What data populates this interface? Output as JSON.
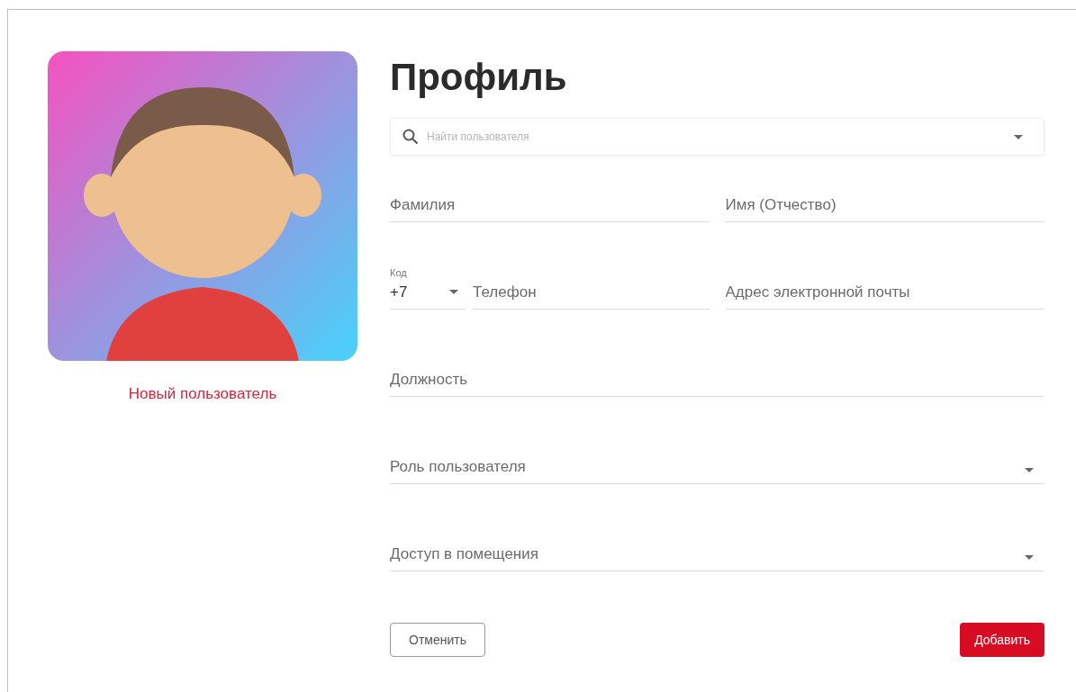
{
  "avatar": {
    "caption": "Новый пользователь"
  },
  "title": "Профиль",
  "search": {
    "placeholder": "Найти пользователя"
  },
  "fields": [
    {
      "kind": "text",
      "placeholder": "Фамилия"
    },
    {
      "kind": "text",
      "placeholder": "Имя (Отчество)"
    },
    {
      "kind": "phone",
      "code_label": "Код",
      "code_value": "+7",
      "placeholder": "Телефон"
    },
    {
      "kind": "text",
      "placeholder": "Адрес электронной почты"
    },
    {
      "kind": "wide",
      "placeholder": "Должность"
    },
    {
      "kind": "select",
      "placeholder": "Роль пользователя"
    },
    {
      "kind": "select",
      "placeholder": "Доступ в помещения"
    }
  ],
  "buttons": [
    {
      "label": "Отменить",
      "kind": "secondary"
    },
    {
      "label": "Добавить",
      "kind": "primary"
    }
  ]
}
